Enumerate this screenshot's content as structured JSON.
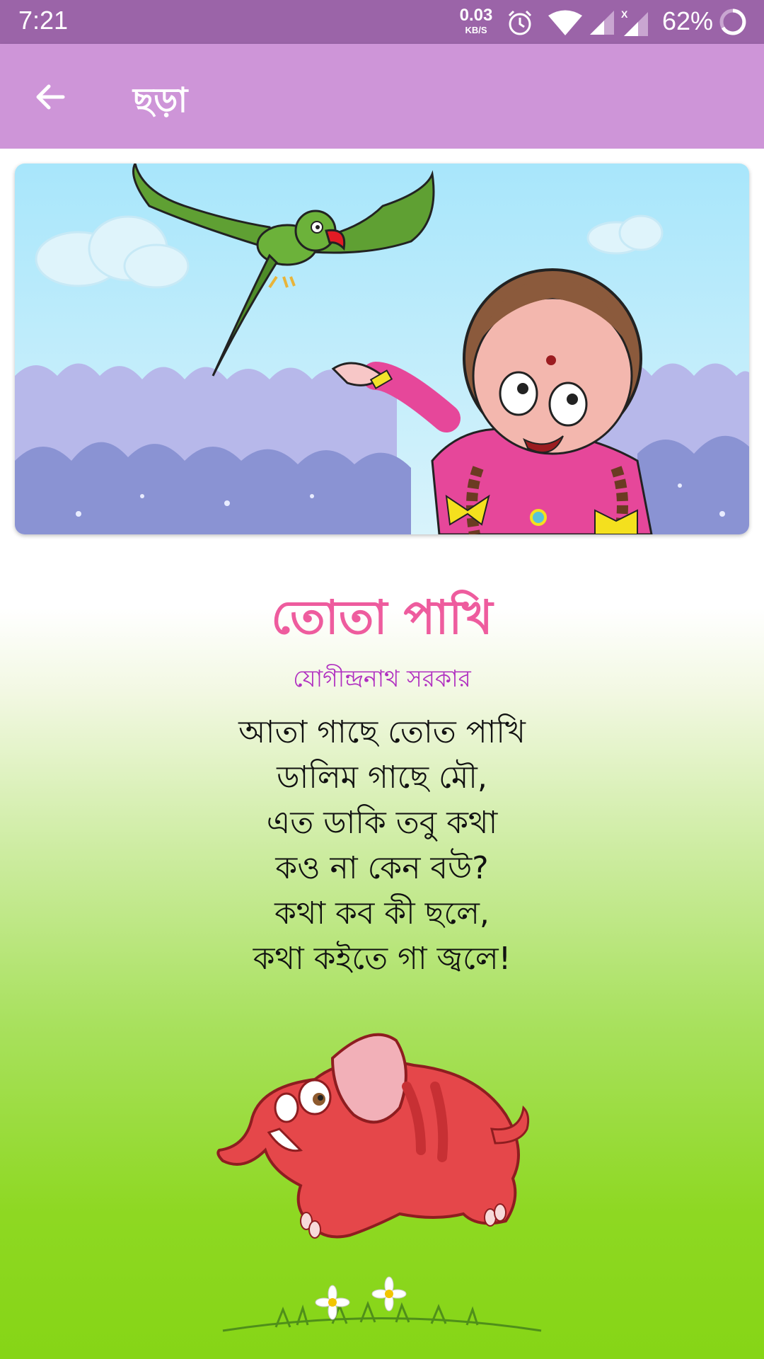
{
  "status_bar": {
    "time": "7:21",
    "net_speed_value": "0.03",
    "net_speed_unit": "KB/S",
    "battery_percent": "62%",
    "icons": [
      "alarm-icon",
      "wifi-icon",
      "signal-icon",
      "signal-x-icon",
      "battery-icon"
    ]
  },
  "app_bar": {
    "title": "ছড়া",
    "back_icon": "arrow-back-icon"
  },
  "banner": {
    "image": "parrot-and-girl-illustration"
  },
  "poem": {
    "title": "তোতা পাখি",
    "author": "যোগীন্দ্রনাথ সরকার",
    "lines": [
      "আতা গাছে তোত পাখি",
      "ডালিম গাছে মৌ,",
      "এত ডাকি তবু কথা",
      "কও না কেন বউ?",
      "কথা কব কী ছলে,",
      "কথা কইতে গা জ্বলে!"
    ]
  },
  "decorations": {
    "bottom_image": "red-elephant-illustration",
    "ground_image": "grass-and-daisies-illustration"
  },
  "colors": {
    "status_bar": "#9b64a8",
    "app_bar": "#ce95d8",
    "title": "#ee5c9e",
    "author": "#b02fc0"
  }
}
